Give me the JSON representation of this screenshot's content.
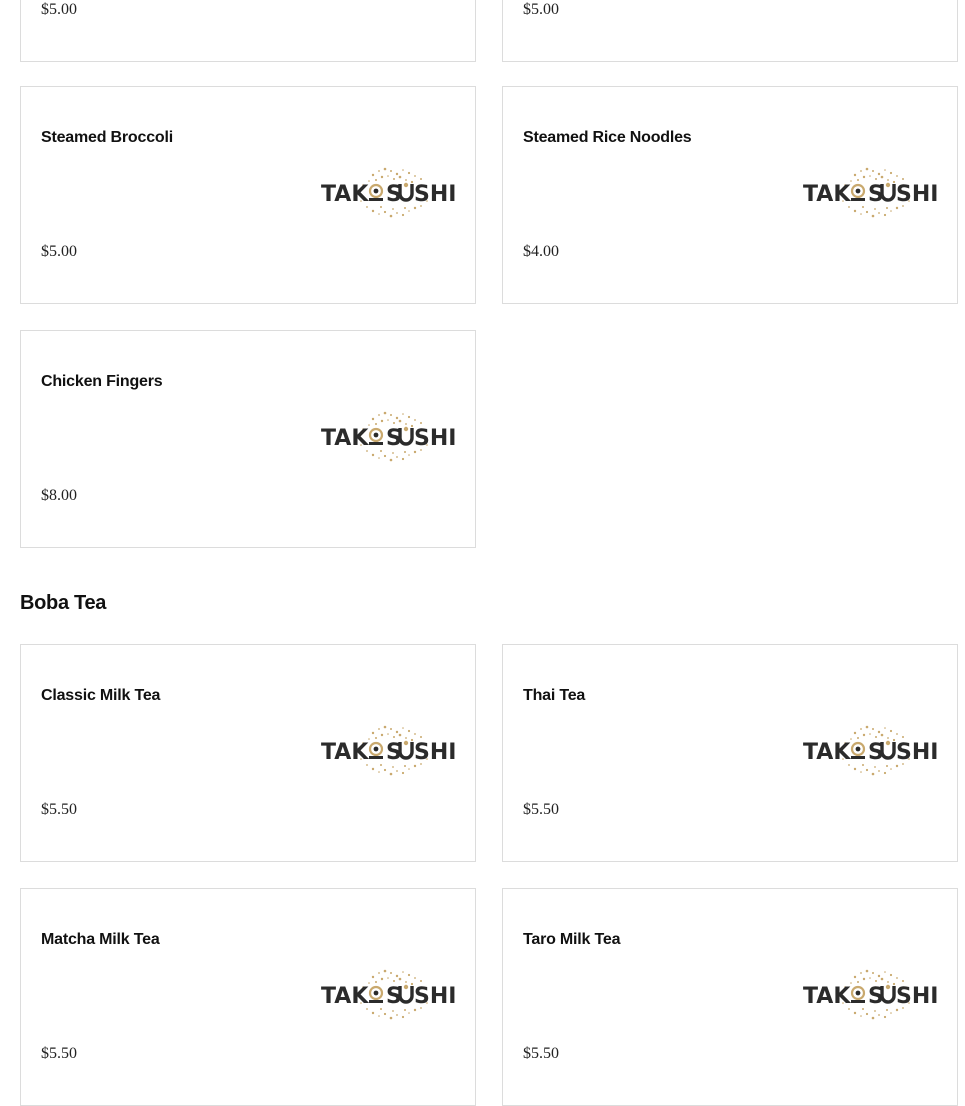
{
  "logo_text": "TAKO SUSHI",
  "brand_colors": {
    "logo_text": "#2b2b2b",
    "logo_accent": "#c9a96e"
  },
  "top_items": [
    {
      "price": "$5.00"
    },
    {
      "price": "$5.00"
    }
  ],
  "items_group_a": [
    {
      "name": "Steamed Broccoli",
      "price": "$5.00"
    },
    {
      "name": "Steamed Rice Noodles",
      "price": "$4.00"
    },
    {
      "name": "Chicken Fingers",
      "price": "$8.00"
    }
  ],
  "boba_section": {
    "title": "Boba Tea",
    "items": [
      {
        "name": "Classic Milk Tea",
        "price": "$5.50"
      },
      {
        "name": "Thai Tea",
        "price": "$5.50"
      },
      {
        "name": "Matcha Milk Tea",
        "price": "$5.50"
      },
      {
        "name": "Taro Milk Tea",
        "price": "$5.50"
      }
    ]
  }
}
